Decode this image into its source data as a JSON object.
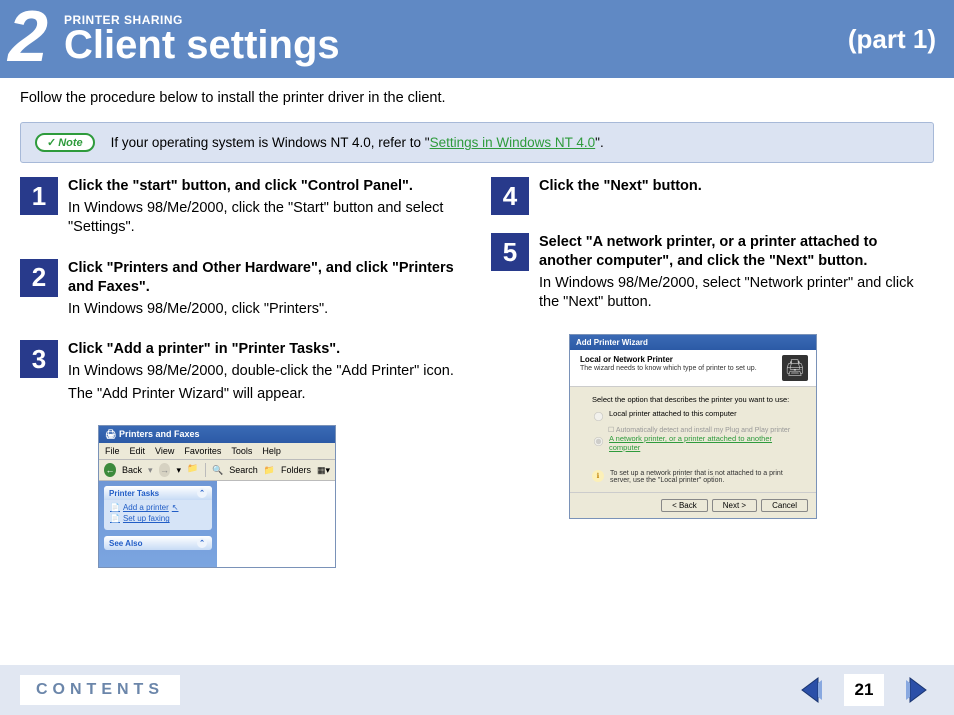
{
  "header": {
    "chapter": "2",
    "eyebrow": "PRINTER SHARING",
    "title": "Client settings",
    "part": "(part 1)"
  },
  "intro": "Follow the procedure below to install the printer driver in the client.",
  "note": {
    "badge": "Note",
    "prefix": "If your operating system is Windows NT 4.0, refer to \"",
    "link": "Settings in Windows NT 4.0",
    "suffix": "\"."
  },
  "steps": {
    "s1": {
      "num": "1",
      "title": "Click the \"start\" button, and click \"Control Panel\".",
      "desc": "In Windows 98/Me/2000, click the \"Start\" button and select \"Settings\"."
    },
    "s2": {
      "num": "2",
      "title": "Click \"Printers and Other Hardware\", and click \"Printers and Faxes\".",
      "desc": "In Windows 98/Me/2000, click \"Printers\"."
    },
    "s3": {
      "num": "3",
      "title": "Click \"Add a printer\" in \"Printer Tasks\".",
      "desc1": "In Windows 98/Me/2000, double-click the \"Add Printer\" icon.",
      "desc2": "The \"Add Printer Wizard\" will appear."
    },
    "s4": {
      "num": "4",
      "title": "Click the \"Next\" button."
    },
    "s5": {
      "num": "5",
      "title": "Select \"A network printer, or a printer attached to another computer\", and click the \"Next\" button.",
      "desc": "In Windows 98/Me/2000, select \"Network printer\" and click the \"Next\" button."
    }
  },
  "shot1": {
    "title": "Printers and Faxes",
    "menu": {
      "file": "File",
      "edit": "Edit",
      "view": "View",
      "fav": "Favorites",
      "tools": "Tools",
      "help": "Help"
    },
    "toolbar": {
      "back": "Back",
      "search": "Search",
      "folders": "Folders"
    },
    "taskpanel": "Printer Tasks",
    "addprinter": "Add a printer",
    "setupfax": "Set up faxing",
    "seealso": "See Also"
  },
  "shot2": {
    "title": "Add Printer Wizard",
    "heading": "Local or Network Printer",
    "subheading": "The wizard needs to know which type of printer to set up.",
    "lead": "Select the option that describes the printer you want to use:",
    "opt1": "Local printer attached to this computer",
    "opt1sub": "Automatically detect and install my Plug and Play printer",
    "opt2": "A network printer, or a printer attached to another computer",
    "info": "To set up a network printer that is not attached to a print server, use the \"Local printer\" option.",
    "back": "< Back",
    "next": "Next >",
    "cancel": "Cancel"
  },
  "footer": {
    "contents": "CONTENTS",
    "page": "21"
  }
}
